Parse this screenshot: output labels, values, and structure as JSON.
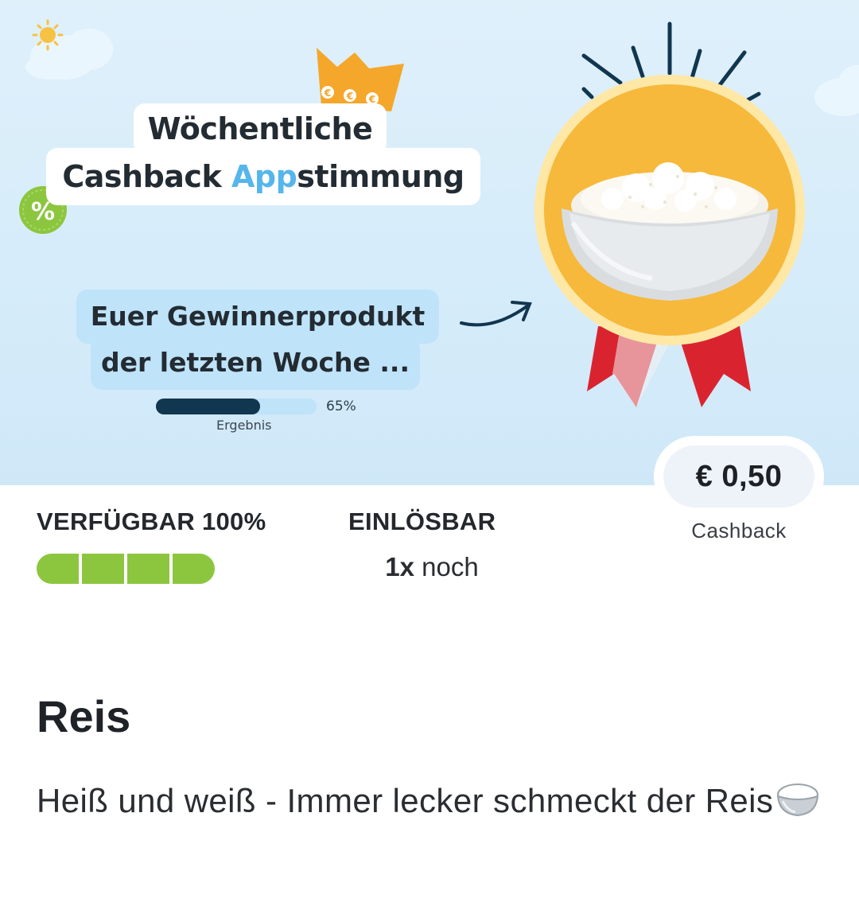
{
  "banner": {
    "title_line1": "Wöchentliche",
    "title_line2_prefix": "Cashback ",
    "title_line2_accent": "App",
    "title_line2_suffix": "stimmung",
    "crown_currency": "€€€",
    "percent_badge": "%",
    "winner_line1": "Euer Gewinnerprodukt",
    "winner_line2": "der letzten Woche ...",
    "result_percent": "65%",
    "result_fraction": 0.65,
    "result_label": "Ergebnis"
  },
  "offer": {
    "price": "€ 0,50",
    "price_caption": "Cashback",
    "available_label": "VERFÜGBAR 100%",
    "available_fraction": 1.0,
    "available_segments": 4,
    "redeemable_label": "EINLÖSBAR",
    "redeemable_count": "1x",
    "redeemable_suffix": "noch"
  },
  "product": {
    "title": "Reis",
    "description": "Heiß und weiß - Immer lecker schmeckt der Reis",
    "description_emoji": "rice-bowl-icon"
  },
  "colors": {
    "accent_blue": "#55b6ec",
    "available_green": "#8cc63f",
    "medal_orange": "#f6b93b",
    "ribbon_red": "#d9242f",
    "badge_green": "#8cc63f",
    "crown_orange": "#f4a72a"
  }
}
